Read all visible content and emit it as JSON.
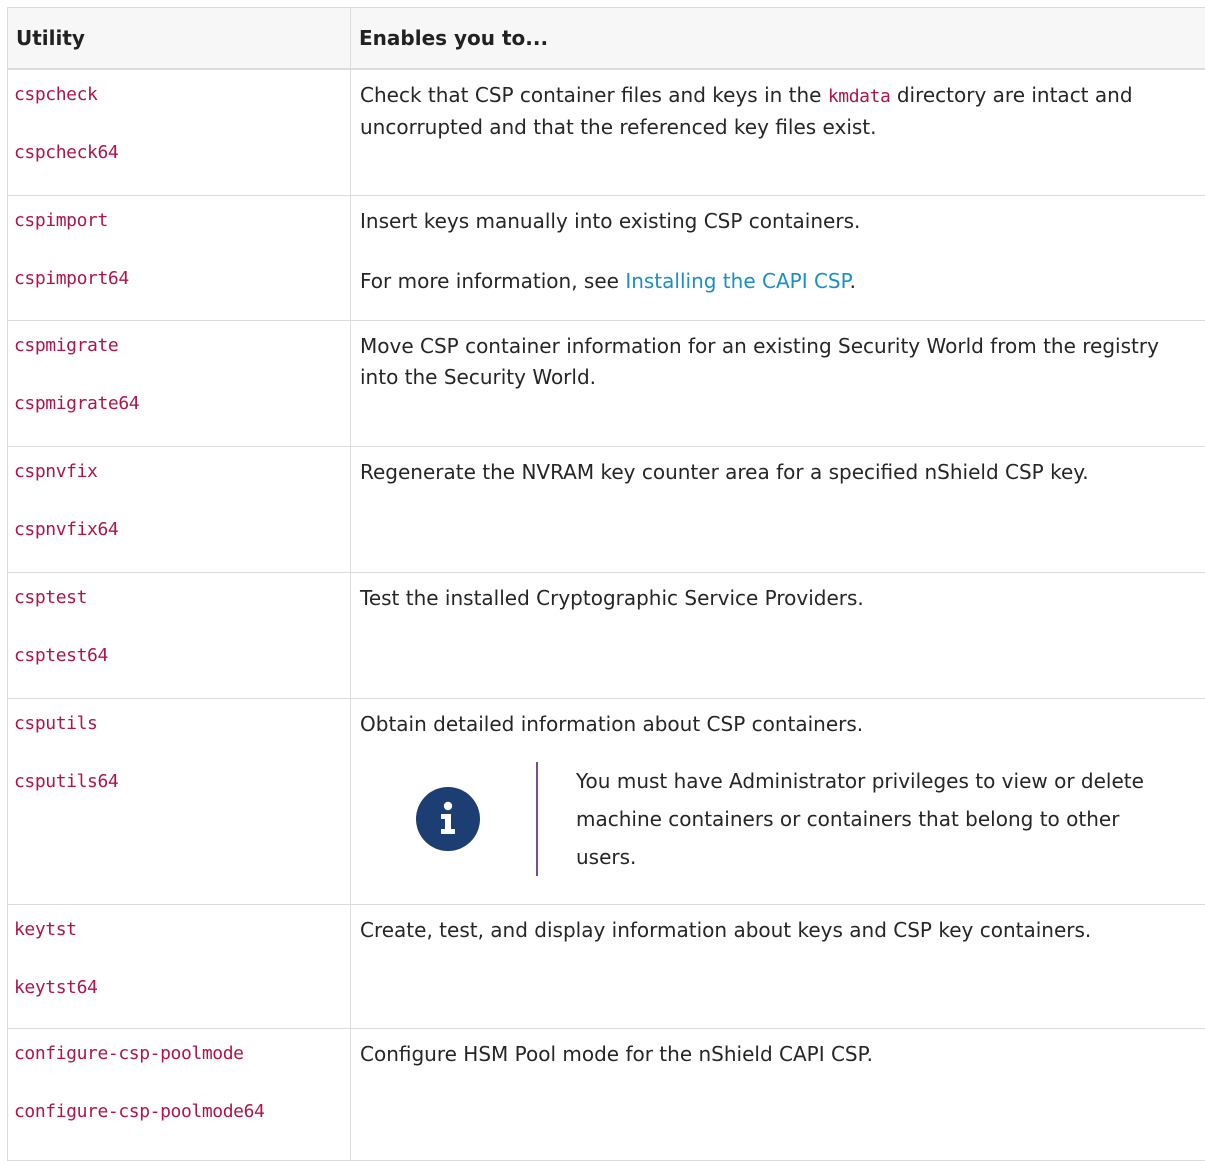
{
  "table": {
    "headers": {
      "utility": "Utility",
      "enables": "Enables you to..."
    },
    "rows": [
      {
        "commands": [
          "cspcheck",
          "cspcheck64"
        ],
        "desc_before": "Check that CSP container files and keys in the ",
        "desc_code": "kmdata",
        "desc_after": " directory are intact and uncorrupted and that the referenced key files exist."
      },
      {
        "commands": [
          "cspimport",
          "cspimport64"
        ],
        "desc": "Insert keys manually into existing CSP containers.",
        "more_before": "For more information, see ",
        "more_link": "Installing the CAPI CSP",
        "more_after": "."
      },
      {
        "commands": [
          "cspmigrate",
          "cspmigrate64"
        ],
        "desc": "Move CSP container information for an existing Security World from the registry into the Security World."
      },
      {
        "commands": [
          "cspnvfix",
          "cspnvfix64"
        ],
        "desc": "Regenerate the NVRAM key counter area for a specified nShield CSP key."
      },
      {
        "commands": [
          "csptest",
          "csptest64"
        ],
        "desc": "Test the installed Cryptographic Service Providers."
      },
      {
        "commands": [
          "csputils",
          "csputils64"
        ],
        "desc": "Obtain detailed information about CSP containers.",
        "note": "You must have Administrator privileges to view or delete machine containers or containers that belong to other users.",
        "note_icon": "info-icon"
      },
      {
        "commands": [
          "keytst",
          "keytst64"
        ],
        "desc": "Create, test, and display information about keys and CSP key containers."
      },
      {
        "commands": [
          "configure-csp-poolmode",
          "configure-csp-poolmode64"
        ],
        "desc": "Configure HSM Pool mode for the nShield CAPI CSP."
      }
    ]
  },
  "colors": {
    "code": "#b0154a",
    "link": "#1a8ec7",
    "note_icon_bg": "#1d3e73",
    "note_rule": "#7b4b8c",
    "header_bg": "#f7f7f7"
  }
}
